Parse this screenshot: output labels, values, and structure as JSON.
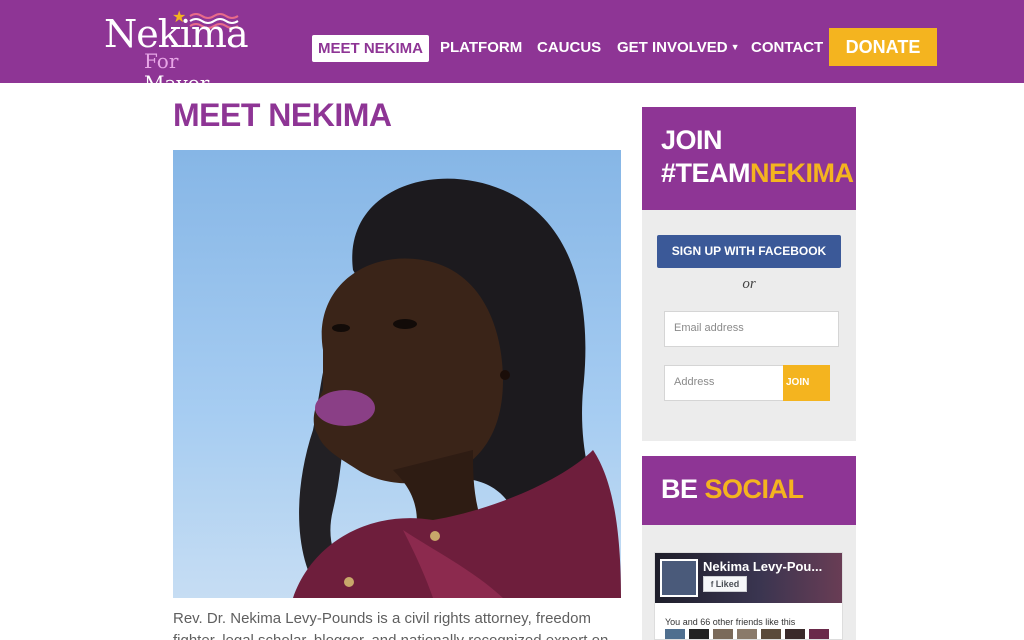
{
  "header": {
    "logo": {
      "name": "Nekima",
      "for": "For",
      "mayor": "Mayor"
    },
    "nav": [
      {
        "label": "MEET NEKIMA",
        "active": true
      },
      {
        "label": "PLATFORM"
      },
      {
        "label": "CAUCUS"
      },
      {
        "label": "GET INVOLVED",
        "has_dropdown": true
      },
      {
        "label": "CONTACT"
      }
    ],
    "donate_label": "DONATE"
  },
  "main": {
    "title": "MEET NEKIMA",
    "bio": "Rev. Dr. Nekima Levy-Pounds is a civil rights attorney, freedom fighter, legal scholar, blogger, and nationally recognized expert on"
  },
  "sidebar": {
    "join": {
      "line1": "JOIN",
      "line2_prefix": "#TEAM",
      "line2_highlight": "NEKIMA",
      "facebook_button": "SIGN UP WITH FACEBOOK",
      "or": "or",
      "email_placeholder": "Email address",
      "address_placeholder": "Address",
      "join_button": "JOIN"
    },
    "social": {
      "title_prefix": "BE ",
      "title_highlight": "SOCIAL",
      "fb_page_name": "Nekima Levy-Pou...",
      "fb_liked_label": "Liked",
      "fb_friends_text": "You and 66 other friends like this"
    }
  },
  "colors": {
    "brand_purple": "#8e3595",
    "accent_yellow": "#f4b41f",
    "facebook_blue": "#3b5998"
  }
}
